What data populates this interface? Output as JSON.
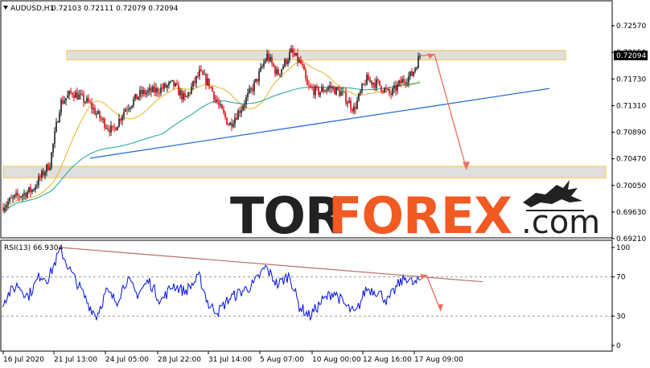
{
  "header": {
    "symbol": "AUDUSD,H1",
    "ohlc": "0.72103 0.72111 0.72079 0.72094"
  },
  "rsi_header": "RSI(13) 66.9304",
  "price_tag": "0.72094",
  "watermark": {
    "tor": "TOR",
    "forex": "FOREX",
    "com": ".com"
  },
  "colors": {
    "bull_candle": "#1a1a1a",
    "bear_candle": "#e8000b",
    "ma_fast": "#e6b422",
    "ma_slow": "#1aa39a",
    "trendline": "#2a6fdb",
    "forecast_arrow": "#f06b5b",
    "rsi_line": "#0010e0",
    "rsi_trendline": "#b5706a",
    "zone_fill": "#d9d9d9",
    "zone_border": "#f0c64a",
    "price_tag_bg": "#000000"
  },
  "chart_data": [
    {
      "type": "candlestick",
      "title": "AUDUSD,H1",
      "x_tick_labels": [
        "16 Jul 2020",
        "21 Jul 13:00",
        "24 Jul 05:00",
        "28 Jul 22:00",
        "31 Jul 14:00",
        "5 Aug 07:00",
        "10 Aug 00:00",
        "12 Aug 16:00",
        "17 Aug 09:00"
      ],
      "y_tick_labels": [
        "0.72570",
        "0.72150",
        "0.71730",
        "0.71310",
        "0.70890",
        "0.70470",
        "0.70050",
        "0.69630",
        "0.69210"
      ],
      "ylim": [
        0.6921,
        0.7257
      ],
      "last_price": 0.72094,
      "close_path": [
        [
          0,
          0.697
        ],
        [
          18,
          0.6985
        ],
        [
          40,
          0.6998
        ],
        [
          62,
          0.704
        ],
        [
          75,
          0.7135
        ],
        [
          90,
          0.7152
        ],
        [
          110,
          0.7135
        ],
        [
          125,
          0.711
        ],
        [
          140,
          0.709
        ],
        [
          155,
          0.7125
        ],
        [
          175,
          0.715
        ],
        [
          195,
          0.7155
        ],
        [
          215,
          0.7165
        ],
        [
          230,
          0.714
        ],
        [
          248,
          0.7182
        ],
        [
          260,
          0.7165
        ],
        [
          272,
          0.713
        ],
        [
          285,
          0.71
        ],
        [
          300,
          0.7128
        ],
        [
          318,
          0.7168
        ],
        [
          332,
          0.721
        ],
        [
          345,
          0.718
        ],
        [
          362,
          0.7215
        ],
        [
          375,
          0.7195
        ],
        [
          382,
          0.716
        ],
        [
          395,
          0.7152
        ],
        [
          410,
          0.716
        ],
        [
          425,
          0.715
        ],
        [
          440,
          0.7125
        ],
        [
          455,
          0.7172
        ],
        [
          470,
          0.7165
        ],
        [
          485,
          0.7148
        ],
        [
          500,
          0.717
        ],
        [
          512,
          0.718
        ],
        [
          522,
          0.72094
        ]
      ],
      "zones": [
        {
          "name": "resistance",
          "from": 0.7203,
          "to": 0.7218
        },
        {
          "name": "support",
          "from": 0.7017,
          "to": 0.7035
        }
      ],
      "trendline": {
        "from": [
          112,
          0.7048
        ],
        "to": [
          683,
          0.7158
        ]
      },
      "forecast_path": [
        [
          523,
          0.72094
        ],
        [
          540,
          0.7212
        ],
        [
          580,
          0.703
        ]
      ]
    },
    {
      "type": "line",
      "title": "RSI(13) 66.9304",
      "y_tick_labels": [
        "100",
        "70",
        "30",
        "0"
      ],
      "ylim": [
        0,
        100
      ],
      "levels": [
        70,
        30
      ],
      "last_value": 66.9304,
      "rsi_path": [
        [
          0,
          40
        ],
        [
          10,
          52
        ],
        [
          22,
          62
        ],
        [
          35,
          50
        ],
        [
          50,
          72
        ],
        [
          60,
          68
        ],
        [
          75,
          98
        ],
        [
          88,
          75
        ],
        [
          100,
          58
        ],
        [
          110,
          42
        ],
        [
          120,
          30
        ],
        [
          132,
          55
        ],
        [
          145,
          45
        ],
        [
          158,
          68
        ],
        [
          170,
          52
        ],
        [
          185,
          66
        ],
        [
          200,
          45
        ],
        [
          215,
          62
        ],
        [
          230,
          55
        ],
        [
          248,
          70
        ],
        [
          260,
          40
        ],
        [
          272,
          35
        ],
        [
          285,
          48
        ],
        [
          300,
          55
        ],
        [
          315,
          62
        ],
        [
          330,
          80
        ],
        [
          345,
          62
        ],
        [
          360,
          72
        ],
        [
          372,
          40
        ],
        [
          385,
          30
        ],
        [
          400,
          45
        ],
        [
          415,
          55
        ],
        [
          430,
          40
        ],
        [
          442,
          32
        ],
        [
          455,
          58
        ],
        [
          470,
          55
        ],
        [
          482,
          45
        ],
        [
          495,
          62
        ],
        [
          505,
          70
        ],
        [
          515,
          62
        ],
        [
          522,
          67
        ]
      ],
      "trendline": {
        "from": [
          75,
          100
        ],
        "to": [
          600,
          65
        ]
      },
      "forecast_path": [
        [
          522,
          67
        ],
        [
          530,
          72
        ],
        [
          548,
          35
        ]
      ]
    }
  ]
}
